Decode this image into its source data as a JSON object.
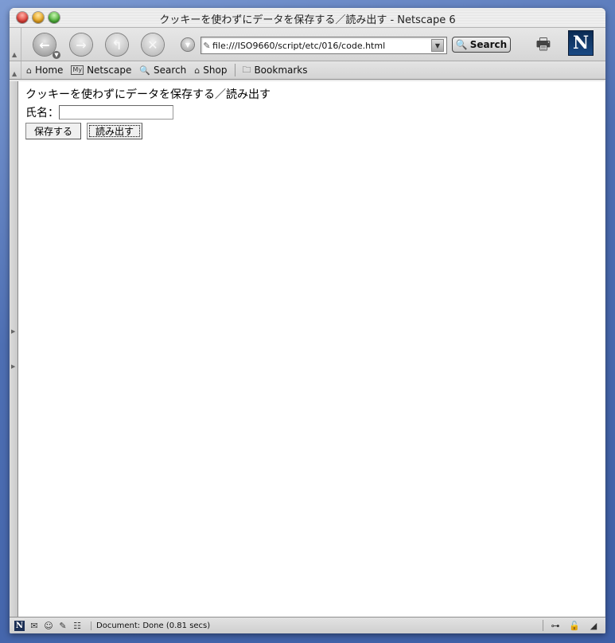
{
  "window": {
    "title": "クッキーを使わずにデータを保存する／読み出す - Netscape 6"
  },
  "navbar": {
    "back_icon": "back-arrow-icon",
    "forward_icon": "forward-arrow-icon",
    "reload_icon": "reload-icon",
    "stop_icon": "stop-icon",
    "url": "file:///ISO9660/script/etc/016/code.html",
    "search_label": "Search"
  },
  "personal_toolbar": {
    "items": [
      {
        "label": "Home",
        "icon": "home-icon"
      },
      {
        "label": "Netscape",
        "icon": "my-netscape-icon"
      },
      {
        "label": "Search",
        "icon": "search-icon"
      },
      {
        "label": "Shop",
        "icon": "shop-icon"
      },
      {
        "label": "Bookmarks",
        "icon": "bookmarks-folder-icon"
      }
    ]
  },
  "page": {
    "heading": "クッキーを使わずにデータを保存する／読み出す",
    "name_label": "氏名：",
    "name_value": "",
    "save_label": "保存する",
    "load_label": "読み出す"
  },
  "status": {
    "text": "Document: Done (0.81 secs)"
  }
}
